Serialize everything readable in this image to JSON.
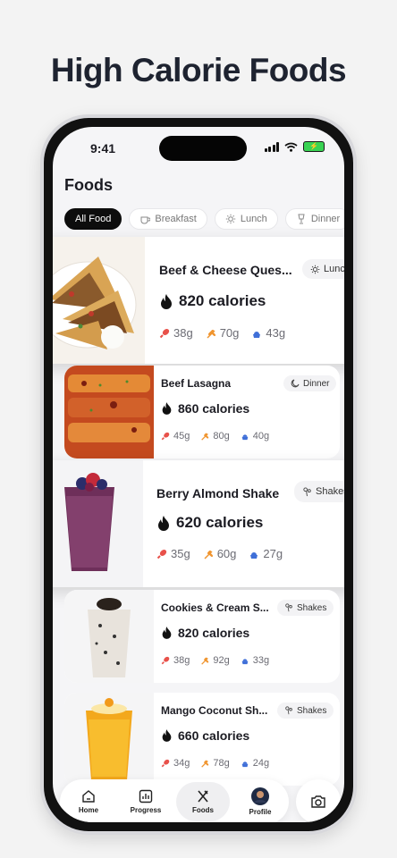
{
  "headline": "High Calorie Foods",
  "status_bar": {
    "time": "9:41"
  },
  "screen_title": "Foods",
  "filters": [
    {
      "label": "All Food",
      "icon": "grid-icon",
      "active": true
    },
    {
      "label": "Breakfast",
      "icon": "coffee-icon",
      "active": false
    },
    {
      "label": "Lunch",
      "icon": "sun-icon",
      "active": false
    },
    {
      "label": "Dinner",
      "icon": "moon-icon",
      "active": false
    }
  ],
  "foods": [
    {
      "name": "Beef & Cheese Ques...",
      "meal": "Lunch",
      "meal_icon": "sun-icon",
      "calories": "820 calories",
      "protein": "38g",
      "carbs": "70g",
      "fat": "43g"
    },
    {
      "name": "Beef Lasagna",
      "meal": "Dinner",
      "meal_icon": "moon-icon",
      "calories": "860 calories",
      "protein": "45g",
      "carbs": "80g",
      "fat": "40g"
    },
    {
      "name": "Berry Almond Shake",
      "meal": "Shakes",
      "meal_icon": "shake-icon",
      "calories": "620 calories",
      "protein": "35g",
      "carbs": "60g",
      "fat": "27g"
    },
    {
      "name": "Cookies & Cream S...",
      "meal": "Shakes",
      "meal_icon": "shake-icon",
      "calories": "820 calories",
      "protein": "38g",
      "carbs": "92g",
      "fat": "33g"
    },
    {
      "name": "Mango Coconut Sh...",
      "meal": "Shakes",
      "meal_icon": "shake-icon",
      "calories": "660 calories",
      "protein": "34g",
      "carbs": "78g",
      "fat": "24g"
    }
  ],
  "nav": [
    {
      "label": "Home",
      "icon": "home-icon",
      "active": false
    },
    {
      "label": "Progress",
      "icon": "chart-icon",
      "active": false
    },
    {
      "label": "Foods",
      "icon": "utensils-icon",
      "active": true
    },
    {
      "label": "Profile",
      "icon": "avatar",
      "active": false
    }
  ],
  "colors": {
    "protein": "#e8514a",
    "carbs": "#f0952f",
    "fat": "#3f6fd8",
    "active_chip": "#0d0d0d"
  }
}
